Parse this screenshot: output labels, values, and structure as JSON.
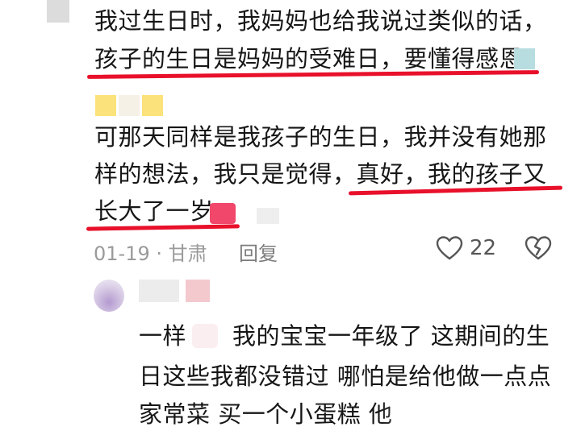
{
  "comment": {
    "lines": [
      "我过生日时，我妈妈也给我说过类似的话，",
      "孩子的生日是妈妈的受难日，要懂得感恩",
      "可那天同样是我孩子的生日，我并没有她那",
      "样的想法，我只是觉得，真好，我的孩子又",
      "长大了一岁"
    ],
    "date": "01-19",
    "separator": "·",
    "location": "甘肃",
    "reply_label": "回复",
    "like_count": "22"
  },
  "reply": {
    "lines": [
      "一样",
      "我的宝宝一年级了  这期间的生",
      "日这些我都没错过  哪怕是给他做一点点",
      "家常菜  买一个小蛋糕 他"
    ]
  },
  "colors": {
    "underline": "#e8102a",
    "text": "#161616",
    "meta": "#9a9a9a"
  }
}
